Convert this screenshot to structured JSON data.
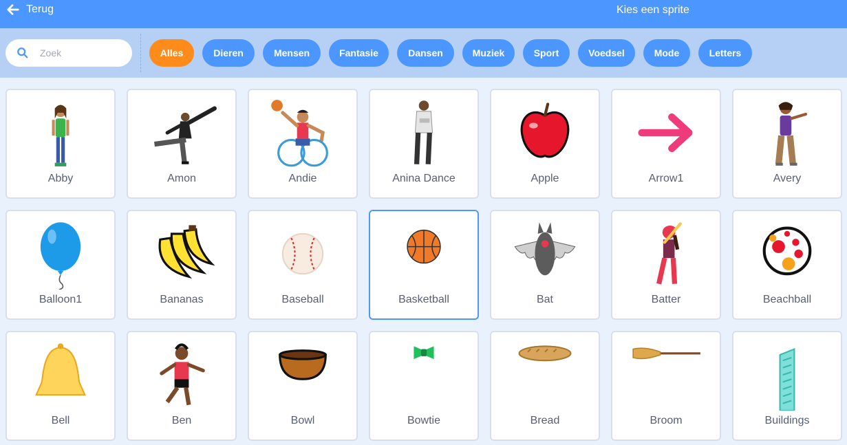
{
  "header": {
    "back_label": "Terug",
    "title": "Kies een sprite"
  },
  "search": {
    "placeholder": "Zoek"
  },
  "tags": [
    "Alles",
    "Dieren",
    "Mensen",
    "Fantasie",
    "Dansen",
    "Muziek",
    "Sport",
    "Voedsel",
    "Mode",
    "Letters"
  ],
  "active_tag": "Alles",
  "sprites": [
    "Abby",
    "Amon",
    "Andie",
    "Anina Dance",
    "Apple",
    "Arrow1",
    "Avery",
    "Balloon1",
    "Bananas",
    "Baseball",
    "Basketball",
    "Bat",
    "Batter",
    "Beachball",
    "Bell",
    "Ben",
    "Bowl",
    "Bowtie",
    "Bread",
    "Broom",
    "Buildings"
  ],
  "selected_sprite": "Basketball",
  "colors": {
    "topbar": "#4c97ff",
    "filterbar": "#b5cff5",
    "active_tag": "#ff8c1a",
    "tag": "#4c97ff",
    "background": "#e9f1fc"
  }
}
